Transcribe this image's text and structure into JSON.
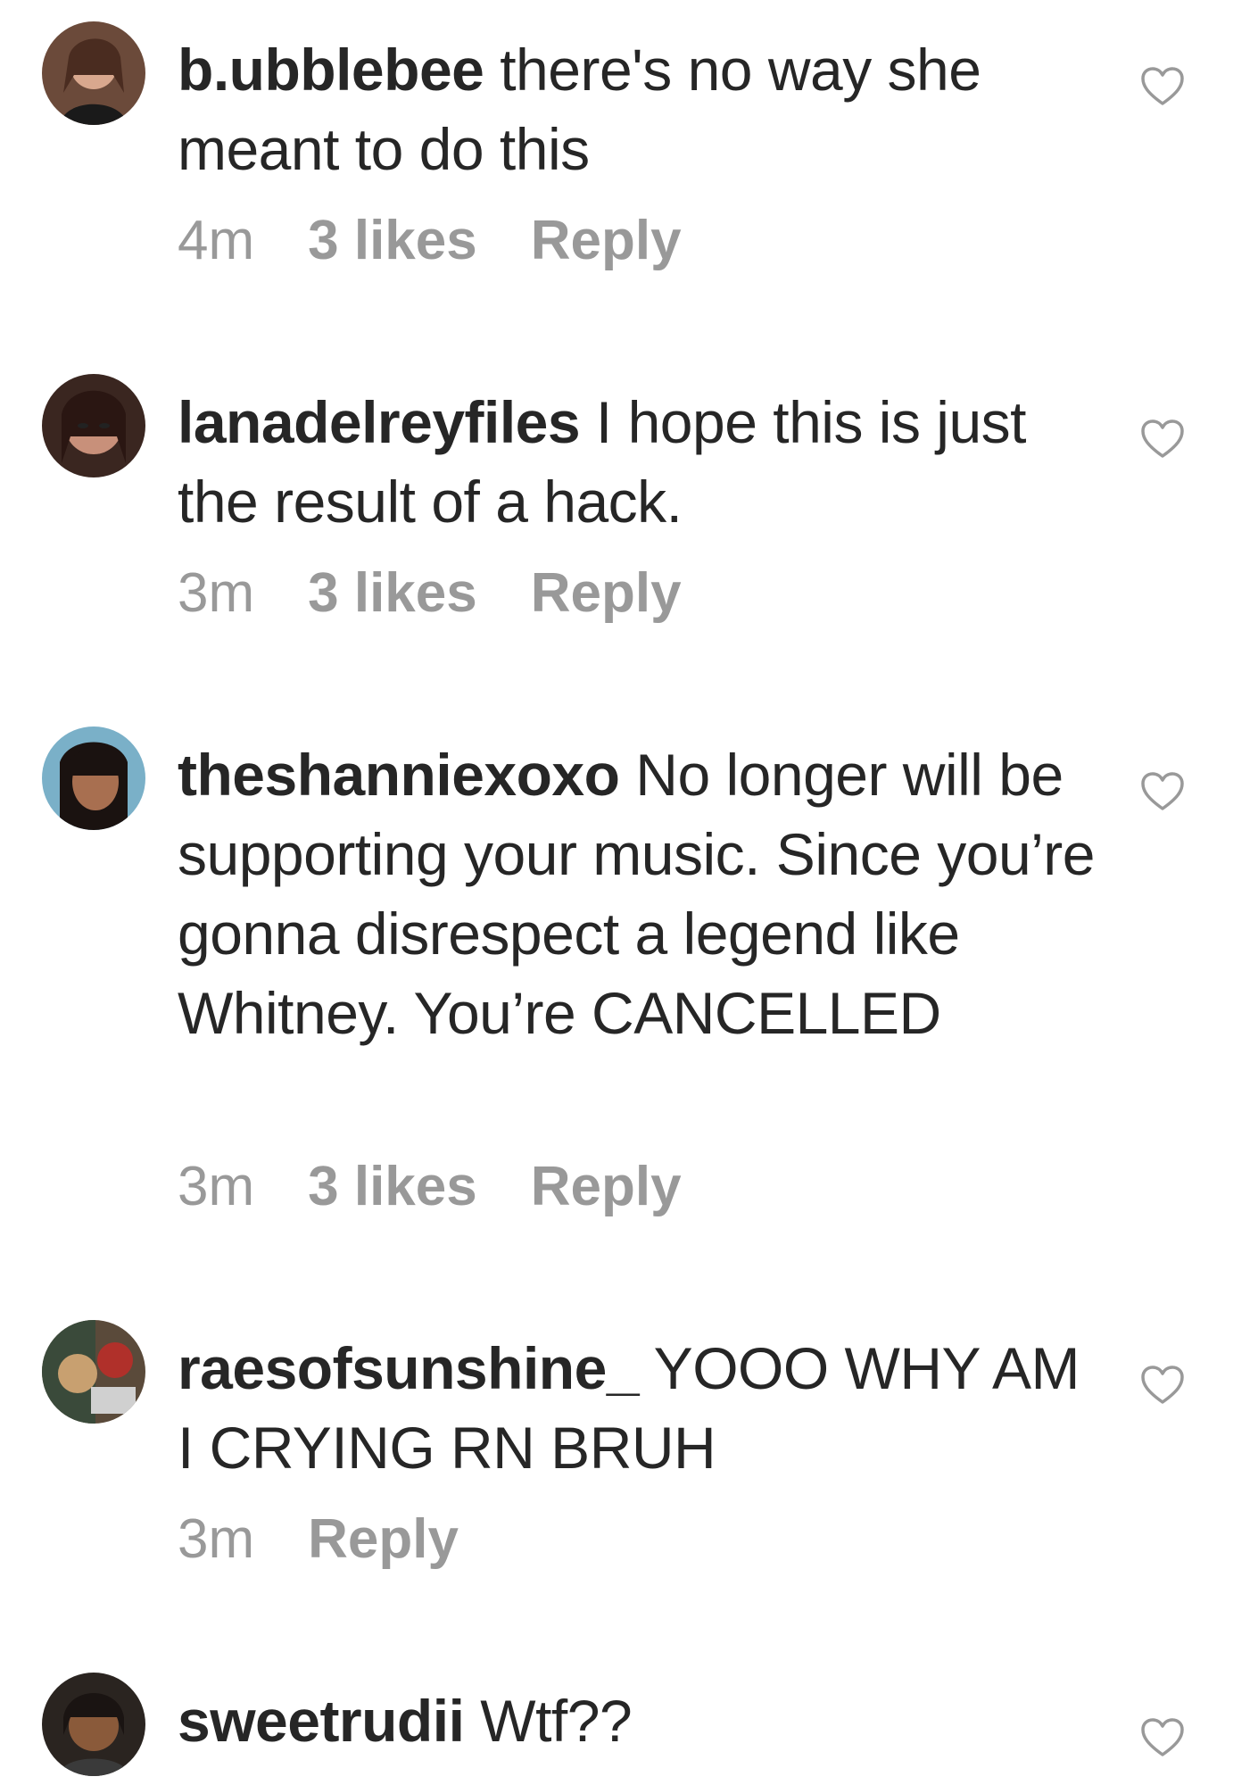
{
  "comments": [
    {
      "username": "b.ubblebee",
      "text": " there's no way she meant to do this",
      "time": "4m",
      "likes": "3 likes",
      "reply": "Reply"
    },
    {
      "username": "lanadelreyfiles",
      "text": " I hope this is just the result of a hack.",
      "time": "3m",
      "likes": "3 likes",
      "reply": "Reply"
    },
    {
      "username": "theshanniexoxo",
      "text": " No longer will be supporting your music. Since you’re gonna disrespect a legend like Whitney. You’re CANCELLED",
      "time": "3m",
      "likes": "3 likes",
      "reply": "Reply"
    },
    {
      "username": "raesofsunshine_",
      "text": " YOOO WHY AM I CRYING RN BRUH",
      "time": "3m",
      "reply": "Reply"
    },
    {
      "username": "sweetrudii",
      "text": " Wtf??"
    }
  ],
  "icons": {
    "like": "heart-outline-icon",
    "avatar": "user-avatar"
  },
  "colors": {
    "text": "#262626",
    "meta": "#999999",
    "heart": "#999999",
    "background": "#ffffff"
  }
}
